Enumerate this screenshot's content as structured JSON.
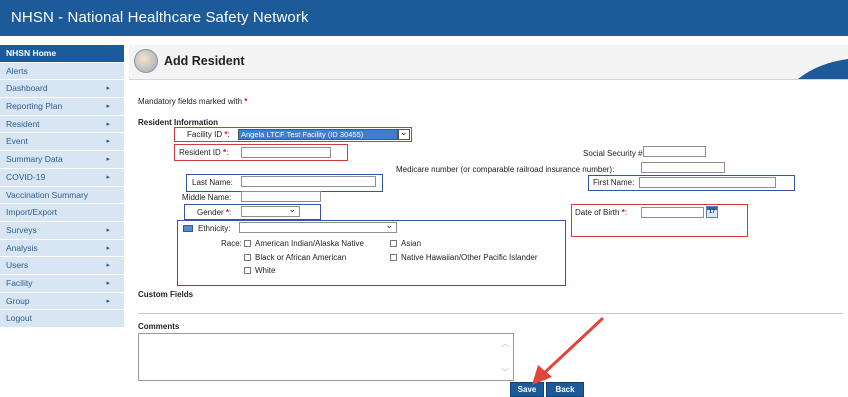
{
  "app": {
    "title": "NHSN - National Healthcare Safety Network"
  },
  "sidebar": {
    "items": [
      {
        "label": "NHSN Home",
        "has_arrow": false
      },
      {
        "label": "Alerts",
        "has_arrow": false
      },
      {
        "label": "Dashboard",
        "has_arrow": true
      },
      {
        "label": "Reporting Plan",
        "has_arrow": true
      },
      {
        "label": "Resident",
        "has_arrow": true
      },
      {
        "label": "Event",
        "has_arrow": true
      },
      {
        "label": "Summary Data",
        "has_arrow": true
      },
      {
        "label": "COVID-19",
        "has_arrow": true
      },
      {
        "label": "Vaccination Summary",
        "has_arrow": false
      },
      {
        "label": "Import/Export",
        "has_arrow": false
      },
      {
        "label": "Surveys",
        "has_arrow": true
      },
      {
        "label": "Analysis",
        "has_arrow": true
      },
      {
        "label": "Users",
        "has_arrow": true
      },
      {
        "label": "Facility",
        "has_arrow": true
      },
      {
        "label": "Group",
        "has_arrow": true
      },
      {
        "label": "Logout",
        "has_arrow": false
      }
    ],
    "arrow_glyph": "▸"
  },
  "page": {
    "title": "Add Resident",
    "mandatory_note": "Mandatory fields marked with",
    "required_mark": "*"
  },
  "section": {
    "resident_info": "Resident Information",
    "custom_fields": "Custom Fields",
    "comments": "Comments"
  },
  "form": {
    "facility_id": {
      "label": "Facility ID",
      "value": "Angela LTCF Test Facility (ID 30455)"
    },
    "resident_id": {
      "label": "Resident ID"
    },
    "ssn": {
      "label": "Social Security #:"
    },
    "medicare": {
      "label": "Medicare number (or comparable railroad insurance number):"
    },
    "last_name": {
      "label": "Last Name:"
    },
    "first_name": {
      "label": "First Name:"
    },
    "middle_name": {
      "label": "Middle Name:"
    },
    "gender": {
      "label": "Gender"
    },
    "dob": {
      "label": "Date of Birth"
    },
    "ethnicity": {
      "label": "Ethnicity:"
    },
    "race": {
      "label": "Race:",
      "options": [
        "American Indian/Alaska Native",
        "Asian",
        "Black or African American",
        "Native Hawaiian/Other Pacific Islander",
        "White"
      ]
    }
  },
  "buttons": {
    "save": "Save",
    "back": "Back"
  },
  "colors": {
    "brand": "#1c5a9a",
    "sidebar_bg": "#d8e6f3",
    "highlight_red": "#d13a3a",
    "highlight_blue": "#2f55a4",
    "arrow": "#e2453c"
  }
}
